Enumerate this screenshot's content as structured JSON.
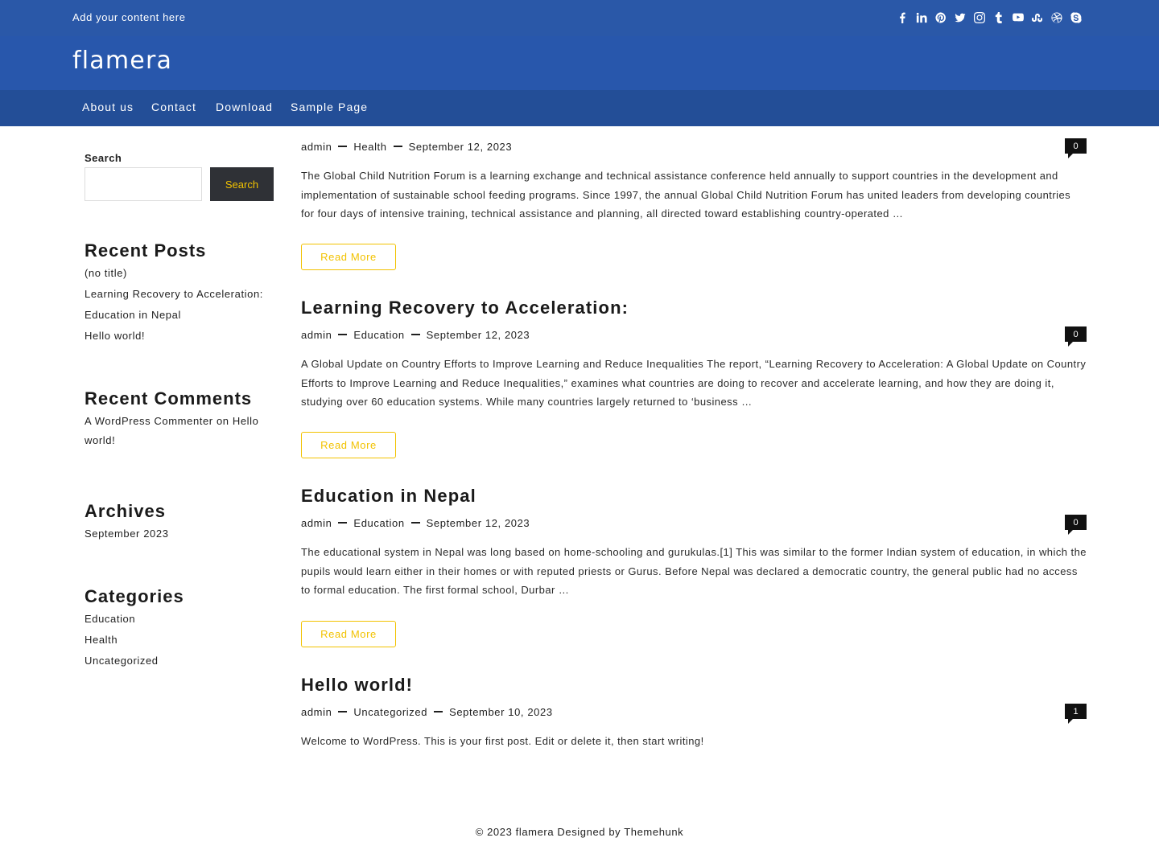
{
  "topbar": {
    "text": "Add your content here",
    "social_icons": [
      "facebook-icon",
      "linkedin-icon",
      "pinterest-icon",
      "twitter-icon",
      "instagram-icon",
      "tumblr-icon",
      "youtube-icon",
      "stumbleupon-icon",
      "dribbble-icon",
      "skype-icon"
    ]
  },
  "brand": {
    "name": "flamera"
  },
  "nav": {
    "items": [
      "About us",
      "Contact",
      "Download",
      "Sample Page"
    ]
  },
  "sidebar": {
    "search": {
      "label": "Search",
      "button": "Search",
      "placeholder": ""
    },
    "recent_posts": {
      "title": "Recent Posts",
      "items": [
        "(no title)",
        "Learning Recovery to Acceleration: Education in Nepal",
        "Hello world!"
      ]
    },
    "recent_comments": {
      "title": "Recent Comments",
      "author": "A WordPress Commenter",
      "connector": " on ",
      "post": "Hello world!"
    },
    "archives": {
      "title": "Archives",
      "items": [
        "September 2023"
      ]
    },
    "categories": {
      "title": "Categories",
      "items": [
        "Education",
        "Health",
        "Uncategorized"
      ]
    }
  },
  "posts": [
    {
      "title": "",
      "author": "admin",
      "category": "Health",
      "date": "September 12, 2023",
      "comments": "0",
      "excerpt": "The Global Child Nutrition Forum is a learning exchange and technical assistance conference held annually to support countries in the development and implementation of sustainable school feeding programs. Since 1997, the annual Global Child Nutrition Forum has united leaders from developing countries for four days of intensive training, technical assistance and planning, all directed toward establishing country-operated …",
      "read_more": "Read More"
    },
    {
      "title": "Learning Recovery to Acceleration:",
      "author": "admin",
      "category": "Education",
      "date": "September 12, 2023",
      "comments": "0",
      "excerpt": "A Global Update on Country Efforts to Improve Learning and Reduce Inequalities The report, “Learning Recovery to Acceleration: A Global Update on Country Efforts to Improve Learning and Reduce Inequalities,” examines what countries are doing to recover and accelerate learning, and how they are doing it, studying over 60 education systems. While many countries largely returned to ‘business …",
      "read_more": "Read More"
    },
    {
      "title": "Education in Nepal",
      "author": "admin",
      "category": "Education",
      "date": "September 12, 2023",
      "comments": "0",
      "excerpt": "The educational system in Nepal was long based on home-schooling and gurukulas.[1] This was similar to the former Indian system of education, in which the pupils would learn either in their homes or with reputed priests or Gurus. Before Nepal was declared a democratic country, the general public had no access to formal education. The first formal school, Durbar …",
      "read_more": "Read More"
    },
    {
      "title": "Hello world!",
      "author": "admin",
      "category": "Uncategorized",
      "date": "September 10, 2023",
      "comments": "1",
      "excerpt": "Welcome to WordPress. This is your first post. Edit or delete it, then start writing!",
      "read_more": ""
    }
  ],
  "footer": {
    "text": "© 2023 flamera Designed by Themehunk"
  },
  "colors": {
    "topbar": "#2a58a8",
    "brandbar": "#2857ac",
    "navbar": "#234e97",
    "accent": "#f2c200",
    "badge": "#111111"
  }
}
